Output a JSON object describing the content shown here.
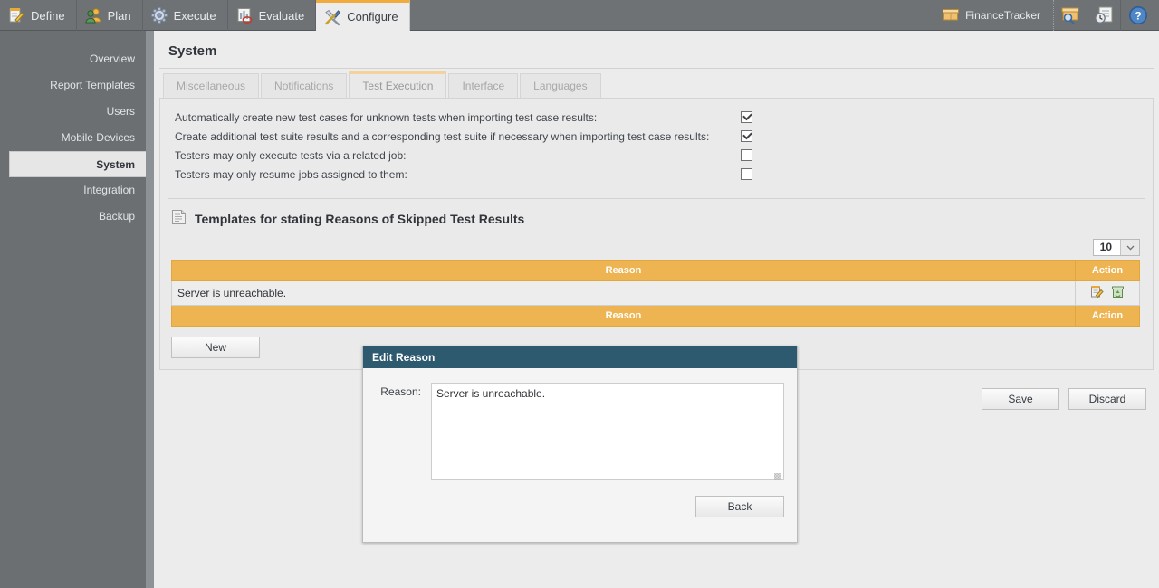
{
  "topbar": {
    "nav": [
      {
        "label": "Define",
        "icon": "notepad-pencil-icon"
      },
      {
        "label": "Plan",
        "icon": "people-icon"
      },
      {
        "label": "Execute",
        "icon": "gear-icon"
      },
      {
        "label": "Evaluate",
        "icon": "chart-report-icon"
      },
      {
        "label": "Configure",
        "icon": "tools-icon"
      }
    ],
    "project": {
      "name": "FinanceTracker",
      "icon": "box-icon"
    },
    "actions": [
      {
        "icon": "box-search-icon"
      },
      {
        "icon": "history-report-icon"
      },
      {
        "icon": "help-icon"
      }
    ]
  },
  "sidebar": {
    "items": [
      {
        "label": "Overview"
      },
      {
        "label": "Report Templates"
      },
      {
        "label": "Users"
      },
      {
        "label": "Mobile Devices"
      },
      {
        "label": "System"
      },
      {
        "label": "Integration"
      },
      {
        "label": "Backup"
      }
    ]
  },
  "page": {
    "title": "System",
    "tabs": [
      {
        "label": "Miscellaneous"
      },
      {
        "label": "Notifications"
      },
      {
        "label": "Test Execution"
      },
      {
        "label": "Interface"
      },
      {
        "label": "Languages"
      }
    ]
  },
  "settings": [
    {
      "label": "Automatically create new test cases for unknown tests when importing test case results:",
      "checked": true
    },
    {
      "label": "Create additional test suite results and a corresponding test suite if necessary when importing test case results:",
      "checked": true
    },
    {
      "label": "Testers may only execute tests via a related job:",
      "checked": false
    },
    {
      "label": "Testers may only resume jobs assigned to them:",
      "checked": false
    }
  ],
  "section": {
    "title": "Templates for stating Reasons of Skipped Test Results",
    "icon": "document-icon"
  },
  "pager": {
    "value": "10",
    "icon": "chevron-down-icon"
  },
  "table": {
    "columns": [
      "Reason",
      "Action"
    ],
    "rows": [
      {
        "reason": "Server is unreachable.",
        "actions": [
          "edit-icon",
          "delete-icon"
        ]
      }
    ]
  },
  "buttons": {
    "new": "New",
    "save": "Save",
    "discard": "Discard"
  },
  "modal": {
    "title": "Edit Reason",
    "field_label": "Reason:",
    "textarea_value": "Server is unreachable.",
    "back": "Back"
  },
  "colors": {
    "accent": "#efb452",
    "modal_header": "#2e5a70",
    "topbar": "#6e7275",
    "sidebar": "#6b6f71"
  }
}
